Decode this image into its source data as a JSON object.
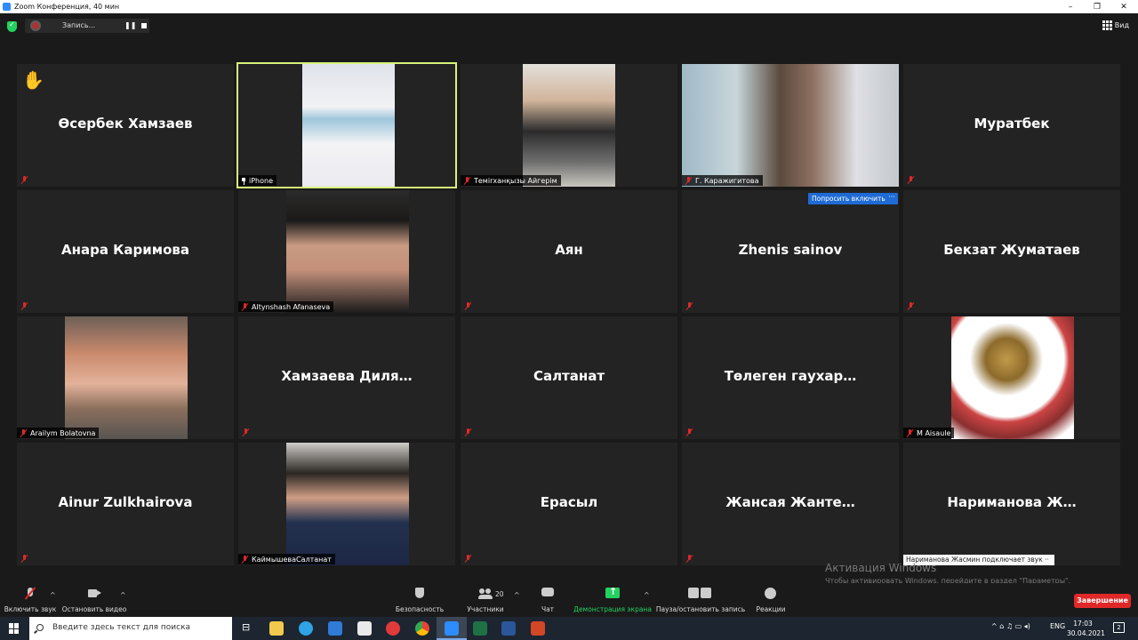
{
  "window": {
    "title": "Zoom Конференция, 40 мин",
    "controls": [
      "–",
      "❐",
      "✕"
    ]
  },
  "topbar": {
    "recording_label": "Запись...",
    "pause_symbol": "❚❚",
    "view_label": "Вид"
  },
  "participants": [
    {
      "name": "Өсербек Хамзаев",
      "label": "",
      "video": false,
      "hand_raised": true,
      "hand_symbol": "✋"
    },
    {
      "name": "",
      "label": "iPhone",
      "video": true,
      "active": true,
      "pinned": true
    },
    {
      "name": "",
      "label": "Теміrханқызы Айгерім",
      "video": true
    },
    {
      "name": "",
      "label": "Г. Каражигитова",
      "video": true
    },
    {
      "name": "Муратбек",
      "label": "",
      "video": false
    },
    {
      "name": "Анара Каримова",
      "label": "",
      "video": false
    },
    {
      "name": "",
      "label": "Altynshash Afanaseva",
      "video": true
    },
    {
      "name": "Аян",
      "label": "",
      "video": false
    },
    {
      "name": "Zhenis sainov",
      "label": "",
      "video": false
    },
    {
      "name": "Бекзат Жуматаев",
      "label": "",
      "video": false
    },
    {
      "name": "",
      "label": "Arailym Bolatovna",
      "video": true
    },
    {
      "name": "Хамзаева  Диля…",
      "label": "",
      "video": false
    },
    {
      "name": "Салтанат",
      "label": "",
      "video": false
    },
    {
      "name": "Төлеген  гаухар…",
      "label": "",
      "video": false
    },
    {
      "name": "",
      "label": "M Aisaule",
      "video": true
    },
    {
      "name": "Ainur Zulkhairova",
      "label": "",
      "video": false
    },
    {
      "name": "",
      "label": "КаймышеваСалтанат",
      "video": true
    },
    {
      "name": "Ерасыл",
      "label": "",
      "video": false
    },
    {
      "name": "Жансая  Жанте…",
      "label": "",
      "video": false
    },
    {
      "name": "Нариманова  Ж…",
      "label": "",
      "video": false
    }
  ],
  "ask_unmute": {
    "label": "Попросить включить",
    "more": "···"
  },
  "join_note": "Нариманова Жасмин подключает звук ··",
  "activation": {
    "title": "Активация Windows",
    "subtitle": "Чтобы активировать Windows, перейдите в раздел \"Параметры\"."
  },
  "toolbar": {
    "unmute": "Включить звук",
    "start_video": "Остановить видео",
    "security": "Безопасность",
    "participants": "Участники",
    "participants_count": "20",
    "chat": "Чат",
    "share": "Демонстрация экрана",
    "pause_record": "Пауза/остановить запись",
    "reactions": "Реакции",
    "end": "Завершение",
    "caret": "^"
  },
  "taskbar": {
    "search_placeholder": "Введите здесь текст для поиска",
    "lang": "ENG",
    "time": "17:03",
    "date": "30.04.2021",
    "notif_count": "2",
    "tray_symbols": "^  ⌂  ♫  ▭  ◂)",
    "taskview_symbol": "⊟"
  },
  "colors": {
    "accent_blue": "#2d8cff",
    "active_speaker": "#d8f27a",
    "muted_red": "#e02828",
    "share_green": "#23d160",
    "end_red": "#e02828"
  }
}
